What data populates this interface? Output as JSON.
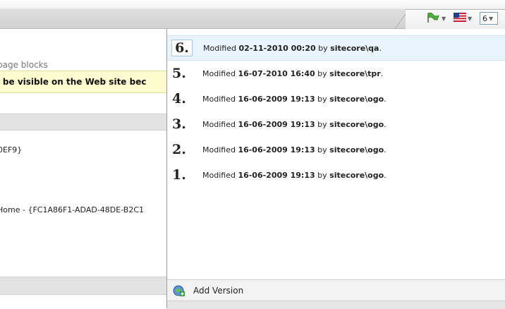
{
  "toolbar": {
    "flag_icon": "green-flag-icon",
    "language_icon": "us-flag-icon",
    "version_selected": "6"
  },
  "background": {
    "blocks_text": "page blocks",
    "warning_text": "t be visible on the Web site bec",
    "id_text": "0EF9}",
    "home_text": "Home - {FC1A86F1-ADAD-48DE-B2C1"
  },
  "versions": [
    {
      "num": "6.",
      "prefix": "Modified ",
      "date": "02-11-2010 00:20",
      "by": " by ",
      "user": "sitecore\\qa",
      "suffix": ".",
      "selected": true
    },
    {
      "num": "5.",
      "prefix": "Modified ",
      "date": "16-07-2010 16:40",
      "by": " by ",
      "user": "sitecore\\tpr",
      "suffix": ".",
      "selected": false
    },
    {
      "num": "4.",
      "prefix": "Modified ",
      "date": "16-06-2009 19:13",
      "by": " by ",
      "user": "sitecore\\ogo",
      "suffix": ".",
      "selected": false
    },
    {
      "num": "3.",
      "prefix": "Modified ",
      "date": "16-06-2009 19:13",
      "by": " by ",
      "user": "sitecore\\ogo",
      "suffix": ".",
      "selected": false
    },
    {
      "num": "2.",
      "prefix": "Modified ",
      "date": "16-06-2009 19:13",
      "by": " by ",
      "user": "sitecore\\ogo",
      "suffix": ".",
      "selected": false
    },
    {
      "num": "1.",
      "prefix": "Modified ",
      "date": "16-06-2009 19:13",
      "by": " by ",
      "user": "sitecore\\ogo",
      "suffix": ".",
      "selected": false
    }
  ],
  "add_version": {
    "label": "Add Version",
    "icon": "add-version-icon"
  },
  "colors": {
    "selected_row": "#eaf4fc",
    "warning_bg": "#fffbd1"
  }
}
